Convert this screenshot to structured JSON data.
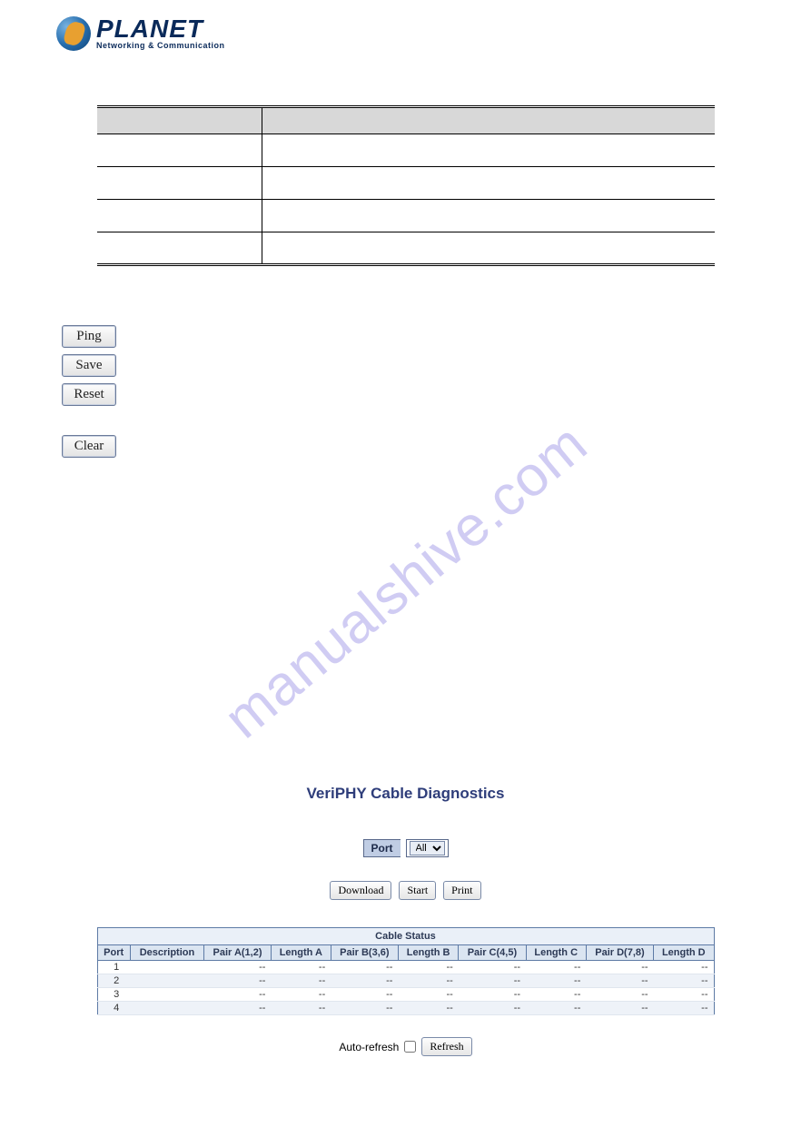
{
  "logo": {
    "title": "PLANET",
    "subtitle": "Networking & Communication"
  },
  "watermark": "manualshive.com",
  "button_stack": {
    "ping": "Ping",
    "save": "Save",
    "reset": "Reset",
    "clear": "Clear"
  },
  "section": {
    "title": "VeriPHY Cable Diagnostics"
  },
  "port_selector": {
    "label": "Port",
    "value": "All"
  },
  "actions": {
    "download": "Download",
    "start": "Start",
    "print": "Print"
  },
  "cable_status": {
    "caption": "Cable Status",
    "headers": [
      "Port",
      "Description",
      "Pair A(1,2)",
      "Length A",
      "Pair B(3,6)",
      "Length B",
      "Pair C(4,5)",
      "Length C",
      "Pair D(7,8)",
      "Length D"
    ],
    "rows": [
      {
        "port": "1",
        "values": [
          "",
          "--",
          "--",
          "--",
          "--",
          "--",
          "--",
          "--",
          "--"
        ]
      },
      {
        "port": "2",
        "values": [
          "",
          "--",
          "--",
          "--",
          "--",
          "--",
          "--",
          "--",
          "--"
        ]
      },
      {
        "port": "3",
        "values": [
          "",
          "--",
          "--",
          "--",
          "--",
          "--",
          "--",
          "--",
          "--"
        ]
      },
      {
        "port": "4",
        "values": [
          "",
          "--",
          "--",
          "--",
          "--",
          "--",
          "--",
          "--",
          "--"
        ]
      }
    ]
  },
  "auto_refresh": {
    "label": "Auto-refresh",
    "refresh_button": "Refresh"
  }
}
